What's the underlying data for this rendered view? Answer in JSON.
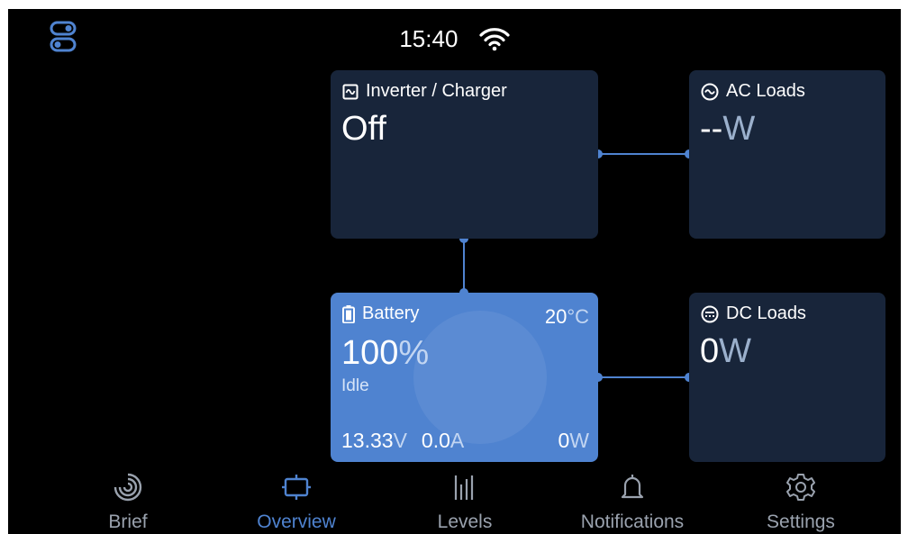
{
  "status_bar": {
    "time": "15:40",
    "wifi_icon": "wifi-icon",
    "menu_icon": "toggles-icon"
  },
  "inverter": {
    "title": "Inverter / Charger",
    "state": "Off",
    "icon": "inverter-icon"
  },
  "ac_loads": {
    "title": "AC Loads",
    "value": "--",
    "unit": "W",
    "icon": "ac-icon"
  },
  "battery": {
    "title": "Battery",
    "temperature": "20",
    "temp_unit": "°C",
    "soc": "100",
    "soc_unit": "%",
    "state": "Idle",
    "voltage": "13.33",
    "voltage_unit": "V",
    "current": "0.0",
    "current_unit": "A",
    "power": "0",
    "power_unit": "W",
    "icon": "battery-icon"
  },
  "dc_loads": {
    "title": "DC Loads",
    "value": "0",
    "unit": "W",
    "icon": "dc-icon"
  },
  "nav": {
    "brief": "Brief",
    "overview": "Overview",
    "levels": "Levels",
    "notifications": "Notifications",
    "settings": "Settings",
    "active": "overview"
  },
  "colors": {
    "accent": "#4f83d0",
    "card": "#18253a",
    "background": "#000000"
  }
}
